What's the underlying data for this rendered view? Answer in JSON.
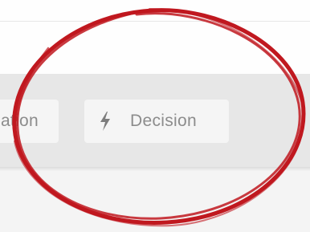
{
  "toolbar": {
    "items": [
      {
        "label": "ation",
        "icon": ""
      },
      {
        "label": "Decision",
        "icon": "lightning-bolt-icon"
      }
    ]
  },
  "annotation": {
    "color": "#c0181f",
    "shape": "ellipse"
  }
}
